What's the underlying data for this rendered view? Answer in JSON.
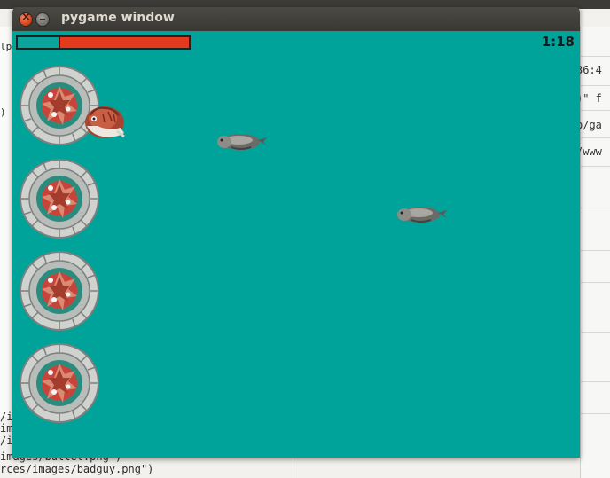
{
  "window": {
    "title": "pygame window"
  },
  "hud": {
    "timer": "1:18",
    "health_fraction": 0.25
  },
  "colors": {
    "background": "#00a39a",
    "health_bar": "#e43a1e",
    "health_remaining": "#0aa49b"
  },
  "background_text": {
    "right_lines": [
      "36:4",
      ")\" f",
      "p/ga",
      "/www"
    ],
    "left_lines": [
      "/im",
      "ima",
      "/im",
      "images/bullet.png\")",
      "rces/images/badguy.png\")"
    ],
    "left_edge": [
      "lp",
      ")"
    ]
  },
  "sprites": {
    "castles": [
      "castle",
      "castle",
      "castle",
      "castle"
    ],
    "player": "player",
    "enemies": [
      "badguy",
      "badguy"
    ]
  }
}
